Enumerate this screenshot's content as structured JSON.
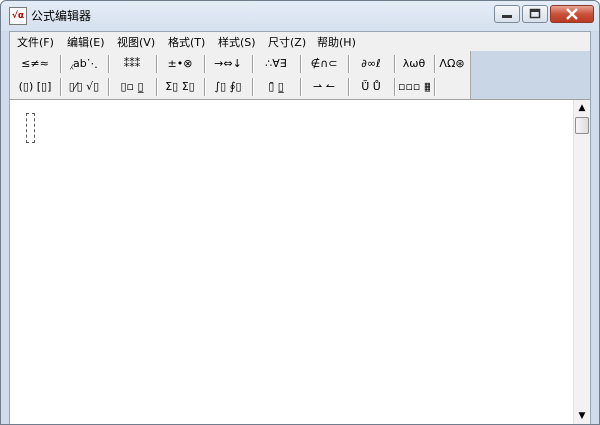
{
  "window": {
    "title": "公式编辑器",
    "app_icon_text": "√α",
    "minimize_icon": "minimize-icon",
    "maximize_icon": "maximize-icon",
    "close_icon": "close-icon"
  },
  "menu": [
    {
      "label": "文件(F)"
    },
    {
      "label": "编辑(E)"
    },
    {
      "label": "视图(V)"
    },
    {
      "label": "格式(T)"
    },
    {
      "label": "样式(S)"
    },
    {
      "label": "尺寸(Z)"
    },
    {
      "label": "帮助(H)"
    }
  ],
  "toolbar": {
    "row1": [
      {
        "label": "≤≠≈",
        "name": "relation-symbols-palette"
      },
      {
        "label": "⁁ab⋱",
        "name": "spaces-ellipses-palette"
      },
      {
        "label": "⁑⁑⁑",
        "name": "embellishments-palette"
      },
      {
        "label": "±•⊗",
        "name": "operator-symbols-palette"
      },
      {
        "label": "→⇔↓",
        "name": "arrow-symbols-palette"
      },
      {
        "label": "∴∀∃",
        "name": "logical-symbols-palette"
      },
      {
        "label": "∉∩⊂",
        "name": "set-theory-symbols-palette"
      },
      {
        "label": "∂∞ℓ",
        "name": "misc-symbols-palette"
      },
      {
        "label": "λωθ",
        "name": "greek-lowercase-palette"
      },
      {
        "label": "ΛΩ⊛",
        "name": "greek-uppercase-palette"
      }
    ],
    "row2": [
      {
        "label": "(▯) [▯]",
        "name": "fence-templates-palette"
      },
      {
        "label": "▯⁄▯ √▯",
        "name": "fraction-radical-templates-palette"
      },
      {
        "label": "▯▫ ▯̲",
        "name": "subscript-superscript-templates-palette"
      },
      {
        "label": "Σ▯ Σ▯",
        "name": "summation-templates-palette"
      },
      {
        "label": "∫▯ ∮▯",
        "name": "integral-templates-palette"
      },
      {
        "label": "▯̄ ▯̲",
        "name": "underbar-overbar-templates-palette"
      },
      {
        "label": "⇀ ↼",
        "name": "labeled-arrow-templates-palette"
      },
      {
        "label": "Ũ̈ Ů",
        "name": "products-set-theory-templates-palette"
      },
      {
        "label": "▫▫▫ ▦",
        "name": "matrix-templates-palette"
      }
    ]
  }
}
